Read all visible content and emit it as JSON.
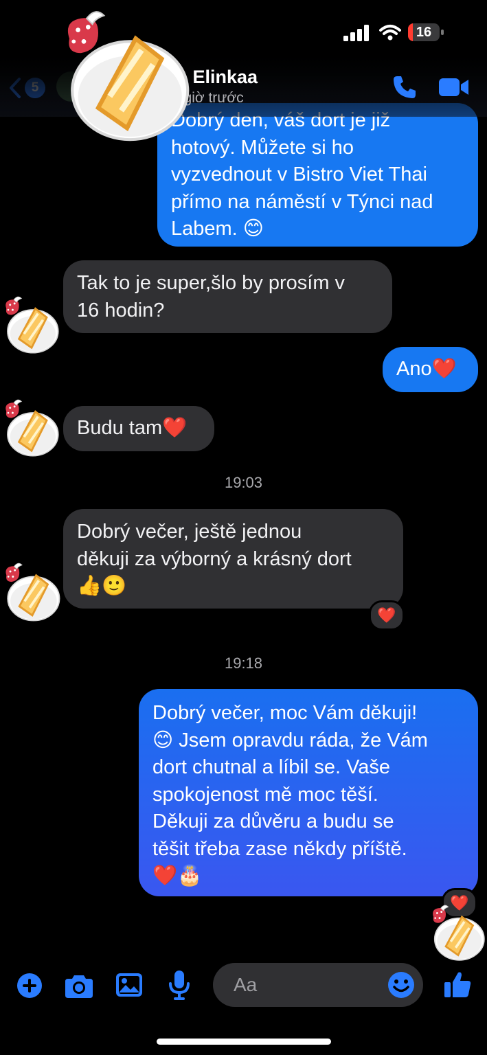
{
  "status_bar": {
    "battery": "16"
  },
  "header": {
    "back_count": "5",
    "contact_name": "a Elinkaa",
    "contact_status": "1 giờ trước"
  },
  "messages": [
    {
      "dir": "out",
      "lines": [
        "Dobrý den, váš dort je již",
        "hotový. Můžete si ho",
        "vyzvednout v Bistro Viet Thai",
        "přímo na náměstí v Týnci nad",
        "Labem. 😊"
      ]
    },
    {
      "dir": "in",
      "lines": [
        "Tak to je super,šlo by prosím v",
        "16 hodin?"
      ]
    },
    {
      "dir": "out",
      "lines": [
        "Ano❤️"
      ]
    },
    {
      "dir": "in",
      "lines": [
        "Budu tam❤️"
      ]
    },
    {
      "dir": "in",
      "lines": [
        "Dobrý večer, ještě jednou",
        "děkuji za výborný a krásný dort",
        "👍🙂"
      ],
      "reaction": "❤️"
    },
    {
      "dir": "out",
      "lines": [
        "Dobrý večer, moc Vám děkuji!",
        "😊 Jsem opravdu ráda, že Vám",
        "dort chutnal a líbil se. Vaše",
        "spokojenost mě moc těší.",
        "Děkuji za důvěru a budu se",
        "těšit třeba zase někdy příště.",
        "❤️🎂"
      ],
      "reaction": "❤️"
    }
  ],
  "timestamps": [
    "19:03",
    "19:18"
  ],
  "composer": {
    "placeholder": "Aa"
  },
  "icons": [
    "back-chevron-icon",
    "phone-icon",
    "video-camera-icon",
    "plus-icon",
    "camera-icon",
    "gallery-icon",
    "microphone-icon",
    "emoji-icon",
    "thumbs-up-icon",
    "cake-sticker"
  ],
  "colors": {
    "accent": "#1778f2",
    "incoming_bubble": "#303033",
    "background": "#000000"
  }
}
